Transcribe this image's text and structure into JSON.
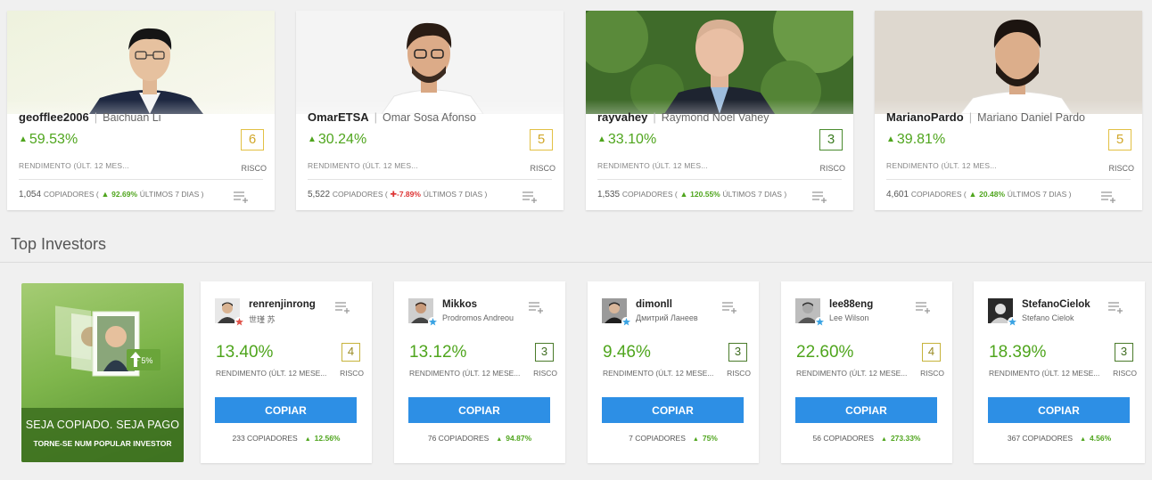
{
  "featured": [
    {
      "username": "geofflee2006",
      "full_name": "Baichuan Li",
      "gain": "59.53%",
      "gain_label": "RENDIMENTO (ÚLT. 12 MES...",
      "risk": "6",
      "risk_label": "RISCO",
      "copiers": "1,054",
      "copiers_label": "COPIADORES (",
      "change": "92.69%",
      "change_label": "ÚLTIMOS 7 DIAS )",
      "change_dir": "up"
    },
    {
      "username": "OmarETSA",
      "full_name": "Omar Sosa Afonso",
      "gain": "30.24%",
      "gain_label": "RENDIMENTO (ÚLT. 12 MES...",
      "risk": "5",
      "risk_label": "RISCO",
      "copiers": "5,522",
      "copiers_label": "COPIADORES (",
      "change": "-7.89%",
      "change_label": "ÚLTIMOS 7 DIAS )",
      "change_dir": "down"
    },
    {
      "username": "rayvahey",
      "full_name": "Raymond Noel Vahey",
      "gain": "33.10%",
      "gain_label": "RENDIMENTO (ÚLT. 12 MES...",
      "risk": "3",
      "risk_label": "RISCO",
      "copiers": "1,535",
      "copiers_label": "COPIADORES (",
      "change": "120.55%",
      "change_label": "ÚLTIMOS 7 DIAS )",
      "change_dir": "up"
    },
    {
      "username": "MarianoPardo",
      "full_name": "Mariano Daniel Pardo",
      "gain": "39.81%",
      "gain_label": "RENDIMENTO (ÚLT. 12 MES...",
      "risk": "5",
      "risk_label": "RISCO",
      "copiers": "4,601",
      "copiers_label": "COPIADORES (",
      "change": "20.48%",
      "change_label": "ÚLTIMOS 7 DIAS )",
      "change_dir": "up"
    }
  ],
  "section": {
    "title": "Top Investors"
  },
  "promo": {
    "line1": "SEJA COPIADO. SEJA PAGO",
    "line2": "TORNE-SE NUM POPULAR INVESTOR",
    "badge": "+ 5%"
  },
  "investors": [
    {
      "username": "renrenjinrong",
      "full_name": "世瑾 苏",
      "gain": "13.40%",
      "gain_label": "RENDIMENTO (ÚLT. 12 MESE...",
      "risk": "4",
      "risk_label": "RISCO",
      "copy_label": "COPIAR",
      "copiers": "233 COPIADORES",
      "change": "12.56%",
      "star_color": "#e0534a"
    },
    {
      "username": "Mikkos",
      "full_name": "Prodromos Andreou",
      "gain": "13.12%",
      "gain_label": "RENDIMENTO (ÚLT. 12 MESE...",
      "risk": "3",
      "risk_label": "RISCO",
      "copy_label": "COPIAR",
      "copiers": "76 COPIADORES",
      "change": "94.87%",
      "star_color": "#3aa3e3"
    },
    {
      "username": "dimonll",
      "full_name": "Дмитрий Ланеев",
      "gain": "9.46%",
      "gain_label": "RENDIMENTO (ÚLT. 12 MESE...",
      "risk": "3",
      "risk_label": "RISCO",
      "copy_label": "COPIAR",
      "copiers": "7 COPIADORES",
      "change": "75%",
      "star_color": "#3aa3e3"
    },
    {
      "username": "lee88eng",
      "full_name": "Lee Wilson",
      "gain": "22.60%",
      "gain_label": "RENDIMENTO (ÚLT. 12 MESE...",
      "risk": "4",
      "risk_label": "RISCO",
      "copy_label": "COPIAR",
      "copiers": "56 COPIADORES",
      "change": "273.33%",
      "star_color": "#3aa3e3"
    },
    {
      "username": "StefanoCielok",
      "full_name": "Stefano Cielok",
      "gain": "18.39%",
      "gain_label": "RENDIMENTO (ÚLT. 12 MESE...",
      "risk": "3",
      "risk_label": "RISCO",
      "copy_label": "COPIAR",
      "copiers": "367 COPIADORES",
      "change": "4.56%",
      "star_color": "#3aa3e3"
    }
  ],
  "icons": {
    "add_to_list": "add-to-watchlist-icon",
    "up": "triangle-up",
    "down": "triangle-down",
    "star": "popular-investor-star"
  },
  "colors": {
    "positive": "#4fa51d",
    "negative": "#dd3333",
    "copy_button": "#2d8fe5",
    "risk_yellow": "#e2c043",
    "risk_green": "#4a8b2e"
  }
}
